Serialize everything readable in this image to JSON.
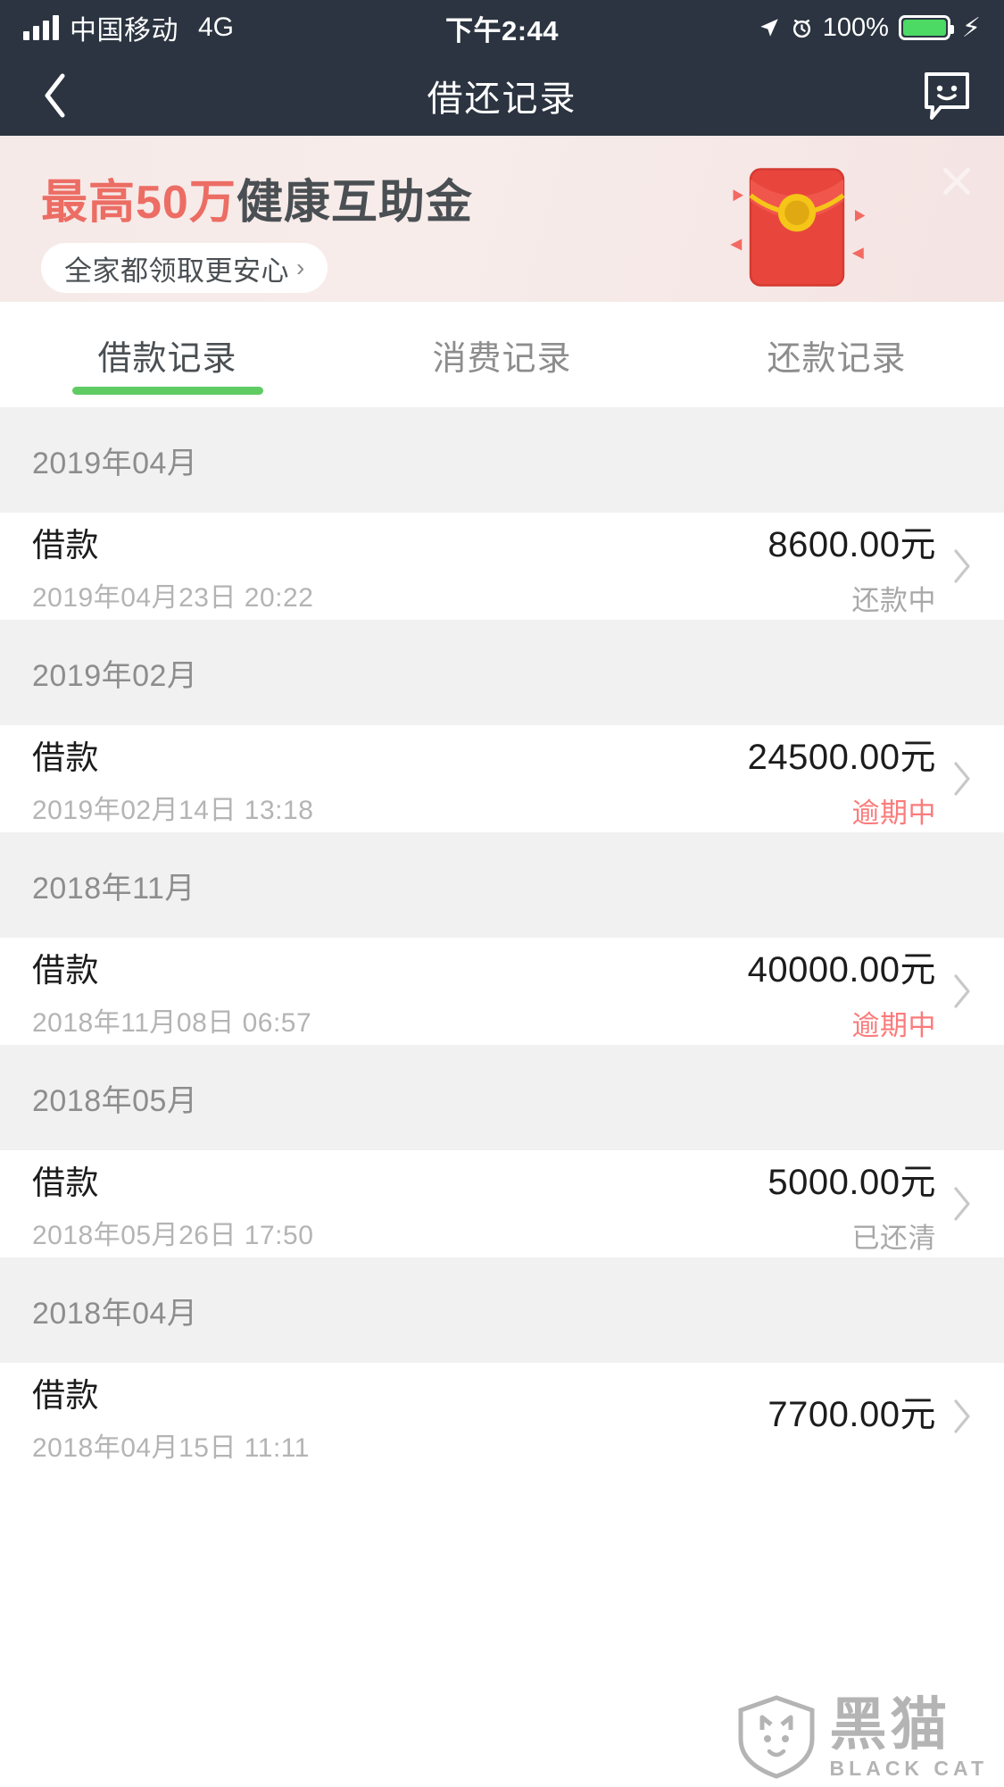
{
  "statusbar": {
    "carrier": "中国移动",
    "network": "4G",
    "time": "下午2:44",
    "battery_percent": "100%",
    "icons": {
      "signal": "signal-bars-icon",
      "location": "location-arrow-icon",
      "alarm": "alarm-clock-icon",
      "battery": "battery-icon",
      "charging": "lightning-bolt-icon"
    }
  },
  "navbar": {
    "title": "借还记录",
    "back_icon": "chevron-left-icon",
    "chat_icon": "smiley-chat-bubble-icon"
  },
  "banner": {
    "headline_highlight": "最高50万",
    "headline_rest": "健康互助金",
    "cta_label": "全家都领取更安心",
    "cta_chevron": "›",
    "close_icon": "close-icon",
    "illustration": "red-envelope-icon",
    "highlight_color": "#ec6d64",
    "text_color": "#4a4f53",
    "background_color": "#f6eae8"
  },
  "tabs": {
    "active_index": 0,
    "active_color": "#5fcc63",
    "items": [
      {
        "label": "借款记录"
      },
      {
        "label": "消费记录"
      },
      {
        "label": "还款记录"
      }
    ]
  },
  "groups": [
    {
      "month": "2019年04月",
      "records": [
        {
          "title": "借款",
          "date": "2019年04月23日 20:22",
          "amount": "8600.00元",
          "status": "还款中",
          "status_color": "#a8a8a8"
        }
      ]
    },
    {
      "month": "2019年02月",
      "records": [
        {
          "title": "借款",
          "date": "2019年02月14日 13:18",
          "amount": "24500.00元",
          "status": "逾期中",
          "status_color": "#fb7b7b"
        }
      ]
    },
    {
      "month": "2018年11月",
      "records": [
        {
          "title": "借款",
          "date": "2018年11月08日 06:57",
          "amount": "40000.00元",
          "status": "逾期中",
          "status_color": "#fb7b7b"
        }
      ]
    },
    {
      "month": "2018年05月",
      "records": [
        {
          "title": "借款",
          "date": "2018年05月26日 17:50",
          "amount": "5000.00元",
          "status": "已还清",
          "status_color": "#a8a8a8"
        }
      ]
    },
    {
      "month": "2018年04月",
      "records": [
        {
          "title": "借款",
          "date": "2018年04月15日 11:11",
          "amount": "7700.00元",
          "status": "",
          "status_color": "#a8a8a8"
        }
      ]
    }
  ],
  "watermark": {
    "cn": "黑猫",
    "en": "BLACK CAT",
    "shield_icon": "shield-cat-icon"
  }
}
